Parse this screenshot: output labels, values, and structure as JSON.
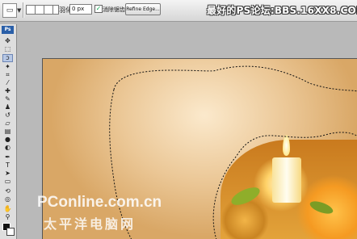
{
  "options_bar": {
    "tool_glyph": "▭",
    "feather_label": "羽化:",
    "feather_value": "0 px",
    "antialias_label": "消除锯齿",
    "antialias_checked": "✓",
    "refine_edge_label": "Refine Edge..."
  },
  "watermark_top": "最好的PS论坛:BBS.16XX8.COM",
  "toolbox": {
    "logo": "Ps"
  },
  "watermark_bottom": {
    "brand": "PConline.com.cn",
    "chinese": "太平洋电脑网"
  },
  "colors": {
    "canvas_tan": "#d9a766",
    "selection": "#111111",
    "toolbox_bg": "#dedede"
  }
}
